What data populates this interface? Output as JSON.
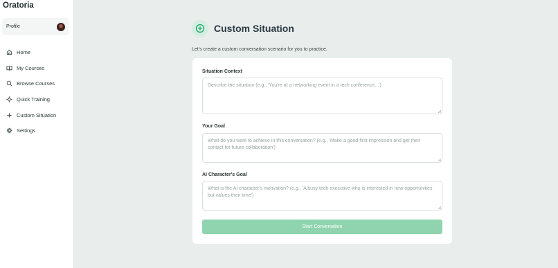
{
  "app": {
    "name": "Oratoria"
  },
  "profile": {
    "label": "Profile"
  },
  "nav": [
    {
      "label": "Home",
      "icon": "home-icon"
    },
    {
      "label": "My Courses",
      "icon": "book-icon"
    },
    {
      "label": "Browse Courses",
      "icon": "search-icon"
    },
    {
      "label": "Quick Training",
      "icon": "sparkle-icon"
    },
    {
      "label": "Custom Situation",
      "icon": "plus-icon"
    },
    {
      "label": "Settings",
      "icon": "gear-icon"
    }
  ],
  "page": {
    "title": "Custom Situation",
    "subtitle": "Let's create a custom conversation scenario for you to practice.",
    "header_icon": "plus-circle-icon"
  },
  "form": {
    "situation": {
      "label": "Situation Context",
      "placeholder": "Describe the situation (e.g., 'You're at a networking event in a tech conference...')"
    },
    "goal": {
      "label": "Your Goal",
      "placeholder": "What do you want to achieve in this conversation? (e.g., 'Make a good first impression and get their contact for future collaboration')"
    },
    "ai_goal": {
      "label": "AI Character's Goal",
      "placeholder": "What is the AI character's motivation? (e.g., 'A busy tech executive who is interested in new opportunities but values their time')"
    },
    "submit_label": "Start Conversation"
  },
  "colors": {
    "accent": "#22a565",
    "button_disabled": "#8fd4ae",
    "background": "#e9edec"
  }
}
